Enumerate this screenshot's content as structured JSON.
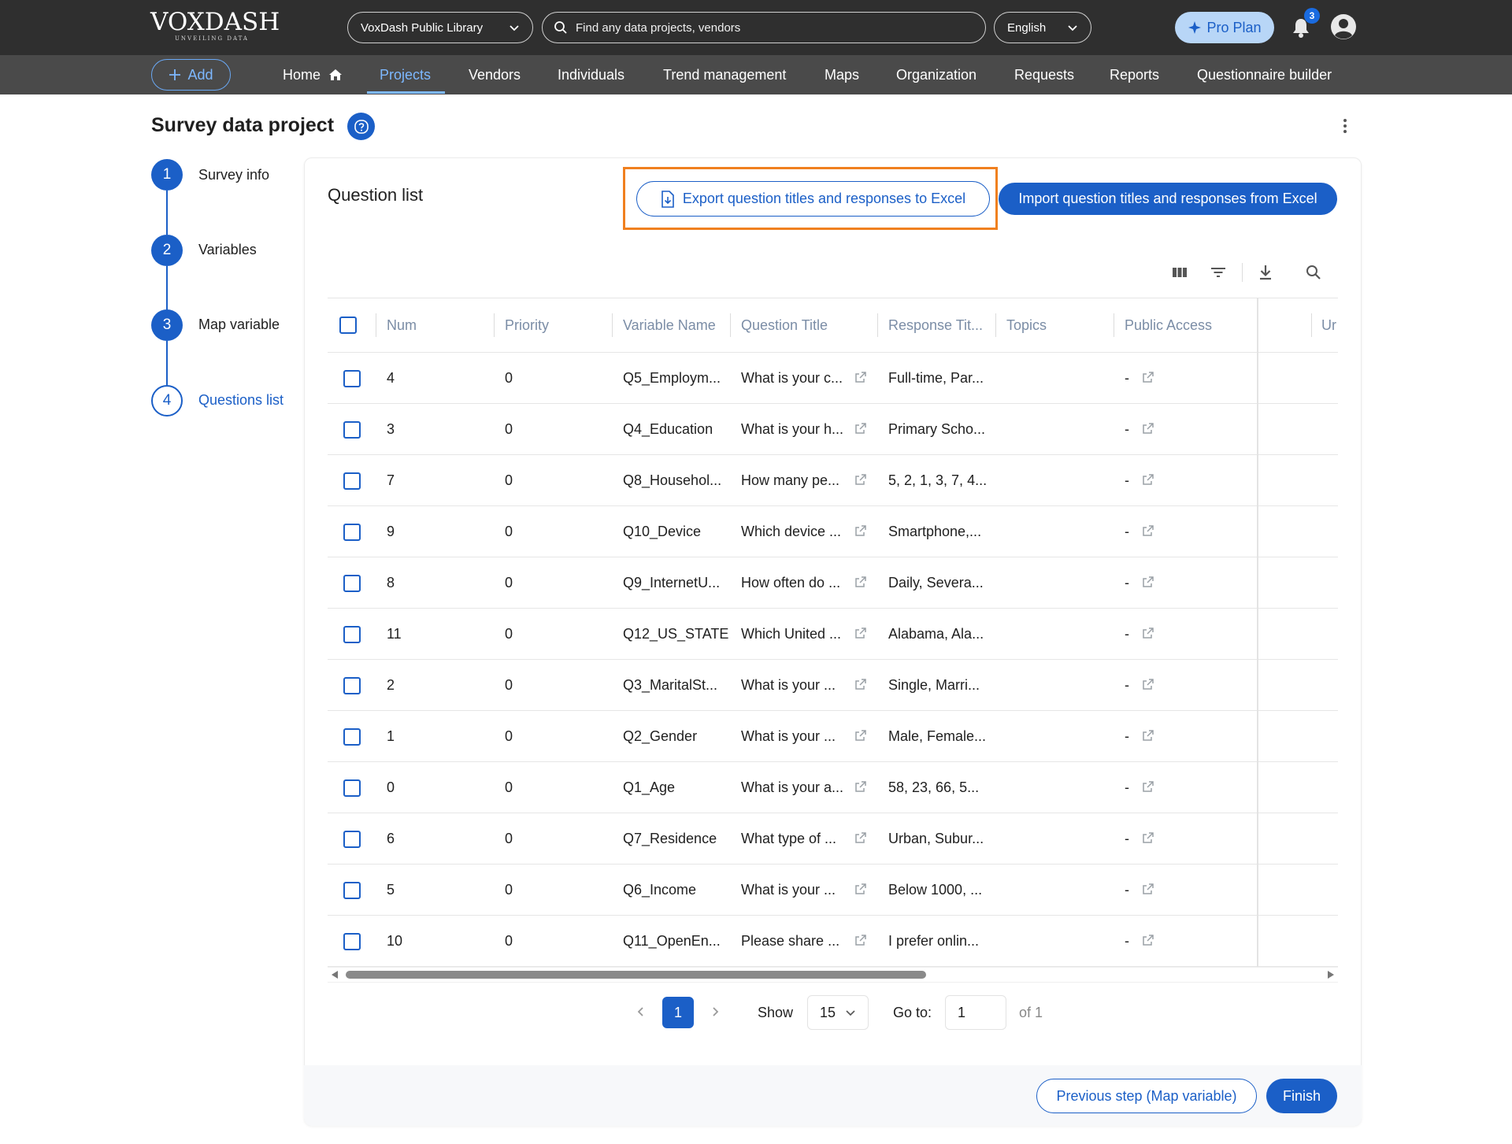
{
  "header": {
    "logo": {
      "name": "VOXDASH",
      "tagline": "UNVEILING DATA"
    },
    "library_select": "VoxDash Public Library",
    "search_placeholder": "Find any data projects, vendors",
    "language_select": "English",
    "pro_plan_label": "Pro Plan",
    "notification_count": "3"
  },
  "nav": {
    "add_label": "Add",
    "items": [
      {
        "label": "Home"
      },
      {
        "label": "Projects",
        "active": true
      },
      {
        "label": "Vendors"
      },
      {
        "label": "Individuals"
      },
      {
        "label": "Trend management"
      },
      {
        "label": "Maps"
      },
      {
        "label": "Organization"
      },
      {
        "label": "Requests"
      },
      {
        "label": "Reports"
      },
      {
        "label": "Questionnaire builder"
      }
    ]
  },
  "page": {
    "title": "Survey data project"
  },
  "steps": [
    {
      "number": "1",
      "label": "Survey info"
    },
    {
      "number": "2",
      "label": "Variables"
    },
    {
      "number": "3",
      "label": "Map variable"
    },
    {
      "number": "4",
      "label": "Questions list",
      "current": true
    }
  ],
  "question_list": {
    "title": "Question list",
    "export_label": "Export question titles and responses to Excel",
    "import_label": "Import question titles and responses from Excel"
  },
  "table": {
    "columns": [
      "Num",
      "Priority",
      "Variable Name",
      "Question Title",
      "Response Tit...",
      "Topics",
      "Public Access",
      "Ur"
    ],
    "rows": [
      {
        "num": "4",
        "priority": "0",
        "variable": "Q5_Employm...",
        "question": "What is your c...",
        "response": "Full-time, Par...",
        "topics": "",
        "public_access": "-"
      },
      {
        "num": "3",
        "priority": "0",
        "variable": "Q4_Education",
        "question": "What is your h...",
        "response": "Primary Scho...",
        "topics": "",
        "public_access": "-"
      },
      {
        "num": "7",
        "priority": "0",
        "variable": "Q8_Househol...",
        "question": "How many pe...",
        "response": "5, 2, 1, 3, 7, 4...",
        "topics": "",
        "public_access": "-"
      },
      {
        "num": "9",
        "priority": "0",
        "variable": "Q10_Device",
        "question": "Which device ...",
        "response": "Smartphone,...",
        "topics": "",
        "public_access": "-"
      },
      {
        "num": "8",
        "priority": "0",
        "variable": "Q9_InternetU...",
        "question": "How often do ...",
        "response": "Daily, Severa...",
        "topics": "",
        "public_access": "-"
      },
      {
        "num": "11",
        "priority": "0",
        "variable": "Q12_US_STATE",
        "question": "Which United ...",
        "response": "Alabama, Ala...",
        "topics": "",
        "public_access": "-"
      },
      {
        "num": "2",
        "priority": "0",
        "variable": "Q3_MaritalSt...",
        "question": "What is your ...",
        "response": "Single, Marri...",
        "topics": "",
        "public_access": "-"
      },
      {
        "num": "1",
        "priority": "0",
        "variable": "Q2_Gender",
        "question": "What is your ...",
        "response": "Male, Female...",
        "topics": "",
        "public_access": "-"
      },
      {
        "num": "0",
        "priority": "0",
        "variable": "Q1_Age",
        "question": "What is your a...",
        "response": "58, 23, 66, 5...",
        "topics": "",
        "public_access": "-"
      },
      {
        "num": "6",
        "priority": "0",
        "variable": "Q7_Residence",
        "question": "What type of ...",
        "response": "Urban, Subur...",
        "topics": "",
        "public_access": "-"
      },
      {
        "num": "5",
        "priority": "0",
        "variable": "Q6_Income",
        "question": "What is your ...",
        "response": "Below 1000, ...",
        "topics": "",
        "public_access": "-"
      },
      {
        "num": "10",
        "priority": "0",
        "variable": "Q11_OpenEn...",
        "question": "Please share ...",
        "response": "I prefer onlin...",
        "topics": "",
        "public_access": "-"
      }
    ]
  },
  "pagination": {
    "current_page": "1",
    "show_label": "Show",
    "page_size": "15",
    "goto_label": "Go to:",
    "goto_value": "1",
    "of_label": "of 1"
  },
  "footer": {
    "previous_label": "Previous step (Map variable)",
    "finish_label": "Finish"
  },
  "colors": {
    "primary": "#1b5fc7",
    "highlight": "#f0801f",
    "topbar": "#2f2f2f",
    "navbar": "#4a4a4a"
  }
}
